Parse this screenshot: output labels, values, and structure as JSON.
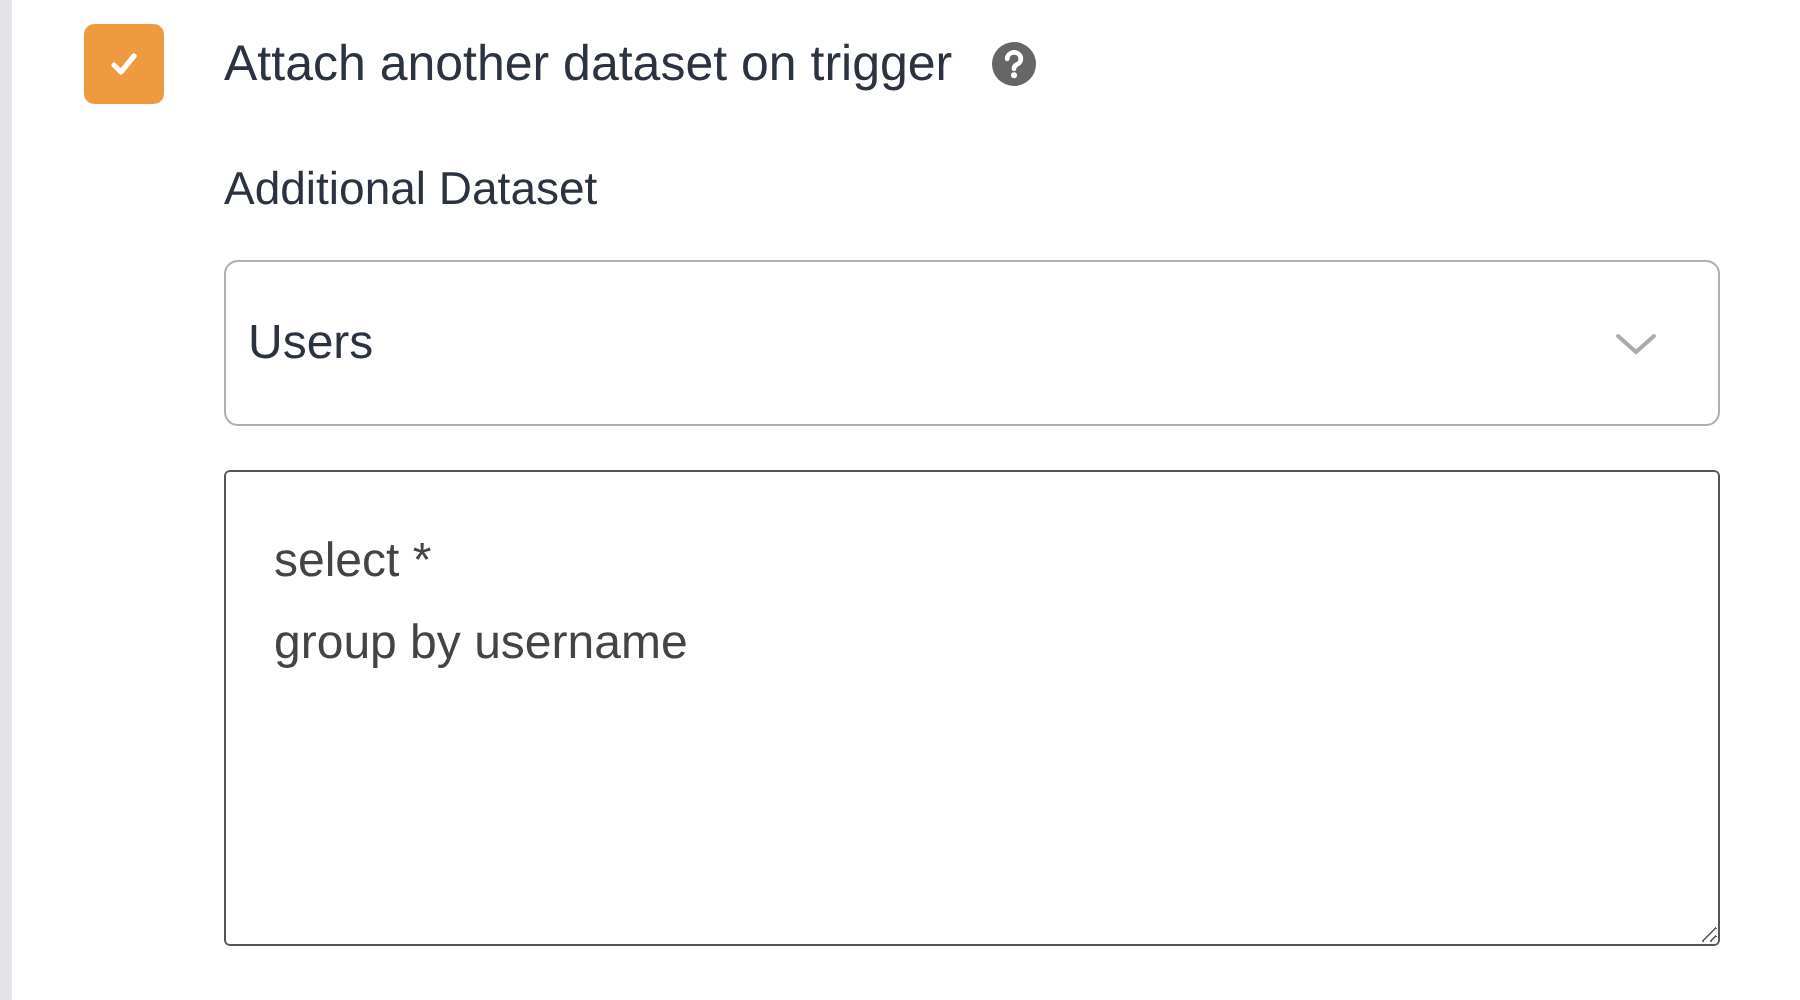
{
  "attach_option": {
    "label": "Attach another dataset on trigger",
    "checked": true
  },
  "additional_dataset": {
    "label": "Additional Dataset",
    "value": "Users"
  },
  "query": {
    "value": "select *\ngroup by username"
  }
}
